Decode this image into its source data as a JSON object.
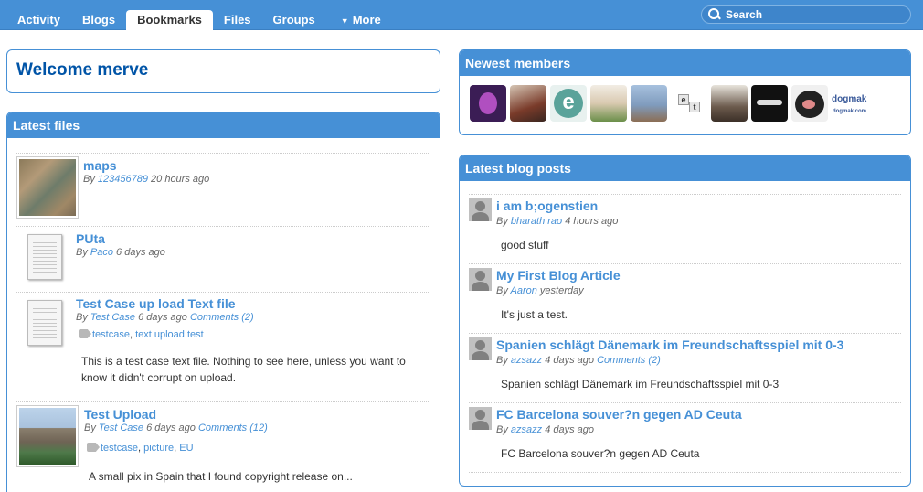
{
  "nav": {
    "tabs": [
      {
        "label": "Activity"
      },
      {
        "label": "Blogs"
      },
      {
        "label": "Bookmarks"
      },
      {
        "label": "Files"
      },
      {
        "label": "Groups"
      },
      {
        "label": "More"
      }
    ],
    "active_tab": "Bookmarks",
    "search_placeholder": "Search"
  },
  "welcome": {
    "title": "Welcome merve"
  },
  "latest_files": {
    "heading": "Latest files",
    "items": [
      {
        "title": "maps",
        "by": "By",
        "author": "123456789",
        "time": "20 hours ago"
      },
      {
        "title": "PUta",
        "by": "By",
        "author": "Paco",
        "time": "6 days ago"
      },
      {
        "title": "Test Case up load Text file",
        "by": "By",
        "author": "Test Case",
        "time": "6 days ago",
        "comments": "Comments (2)",
        "tags": [
          "testcase",
          "text upload test"
        ],
        "description": "This is a test case text file. Nothing to see here, unless you want to know it didn't corrupt on upload."
      },
      {
        "title": "Test Upload",
        "by": "By",
        "author": "Test Case",
        "time": "6 days ago",
        "comments": "Comments (12)",
        "tags": [
          "testcase",
          "picture",
          "EU"
        ],
        "description": "A small pix in Spain that I found copyright release on..."
      }
    ]
  },
  "newest_members": {
    "heading": "Newest members",
    "members": [
      {
        "icon": "cartoon-avatar",
        "color": "#3b1d55"
      },
      {
        "icon": "guitarist-avatar",
        "color": "#7a3b2a"
      },
      {
        "icon": "letter-e-avatar",
        "color": "#5aa39a"
      },
      {
        "icon": "man-smiling-avatar",
        "color": "#d9c9b0"
      },
      {
        "icon": "landscape-avatar",
        "color": "#7f9bbd"
      },
      {
        "icon": "letter-cubes-avatar",
        "color": "#e6e6e6"
      },
      {
        "icon": "man-portrait-avatar",
        "color": "#6b5a4c"
      },
      {
        "icon": "calligraphy-avatar",
        "color": "#111111"
      },
      {
        "icon": "pig-avatar",
        "color": "#222222"
      },
      {
        "icon": "logo-avatar",
        "color": "#ffffff",
        "logo_text": "dogmak",
        "logo_sub": "dogmak.com"
      }
    ]
  },
  "latest_blog_posts": {
    "heading": "Latest blog posts",
    "posts": [
      {
        "title": "i am b;ogenstien",
        "by": "By",
        "author": "bharath rao",
        "time": "4 hours ago",
        "excerpt": "good stuff"
      },
      {
        "title": "My First Blog Article",
        "by": "By",
        "author": "Aaron",
        "time": "yesterday",
        "excerpt": "It's just a test."
      },
      {
        "title": "Spanien schlägt Dänemark im Freundschaftsspiel mit 0-3",
        "by": "By",
        "author": "azsazz",
        "time": "4 days ago",
        "comments": "Comments (2)",
        "excerpt": "Spanien schlägt Dänemark im Freundschaftsspiel mit 0-3"
      },
      {
        "title": "FC Barcelona souver?n gegen AD Ceuta",
        "by": "By",
        "author": "azsazz",
        "time": "4 days ago",
        "excerpt": "FC Barcelona souver?n gegen AD Ceuta"
      }
    ]
  },
  "colors": {
    "accent": "#4690d6",
    "title_blue": "#0054a7"
  }
}
